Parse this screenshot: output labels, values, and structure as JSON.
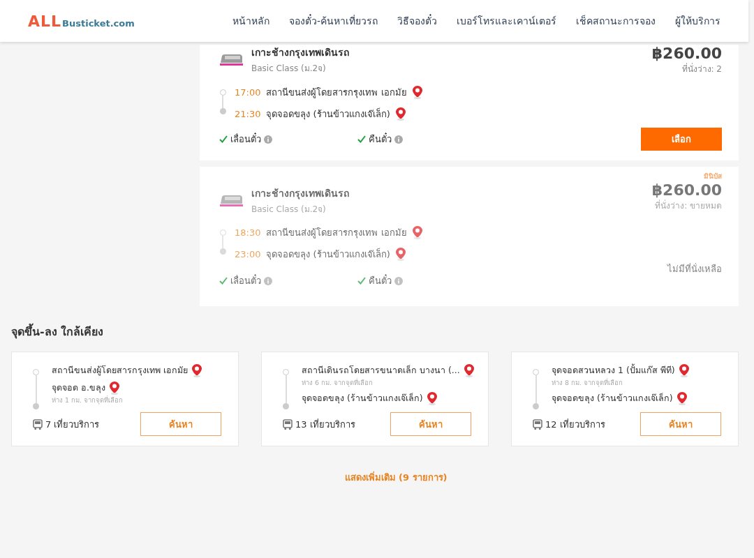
{
  "header": {
    "logo_main": "ALL",
    "logo_sub": "Busticket.com",
    "nav": [
      {
        "label": "หน้าหลัก"
      },
      {
        "label": "จองตั๋ว-ค้นหาเที่ยวรถ"
      },
      {
        "label": "วิธีจองตั๋ว"
      },
      {
        "label": "เบอร์โทรและเคาน์เตอร์"
      },
      {
        "label": "เช็คสถานะการจอง"
      },
      {
        "label": "ผู้ให้บริการ"
      }
    ]
  },
  "trips": [
    {
      "operator": "เกาะช้างกรุงเทพเดินรถ",
      "bus_class": "Basic Class (ม.2จ)",
      "price": "฿260.00",
      "seats": "ที่นั่งว่าง: 2",
      "available": true,
      "stops": [
        {
          "time": "17:00",
          "place": "สถานีขนส่งผู้โดยสารกรุงเทพ เอกมัย"
        },
        {
          "time": "21:30",
          "place": "จุดจอดขลุง (ร้านข้าวแกงเจ๊เล็ก)"
        }
      ],
      "features": [
        {
          "label": "เลื่อนตั๋ว"
        },
        {
          "label": "คืนตั๋ว"
        }
      ],
      "action": "เลือก"
    },
    {
      "badge": "มินิบัส",
      "operator": "เกาะช้างกรุงเทพเดินรถ",
      "bus_class": "Basic Class (ม.2จ)",
      "price": "฿260.00",
      "seats": "ที่นั่งว่าง: ขายหมด",
      "available": false,
      "stops": [
        {
          "time": "18:30",
          "place": "สถานีขนส่งผู้โดยสารกรุงเทพ เอกมัย"
        },
        {
          "time": "23:00",
          "place": "จุดจอดขลุง (ร้านข้าวแกงเจ๊เล็ก)"
        }
      ],
      "features": [
        {
          "label": "เลื่อนตั๋ว"
        },
        {
          "label": "คืนตั๋ว"
        }
      ],
      "status": "ไม่มีที่นั่งเหลือ"
    }
  ],
  "nearby": {
    "title": "จุดขึ้น-ลง ใกล้เคียง",
    "routes": [
      {
        "stops": [
          {
            "place": "สถานีขนส่งผู้โดยสารกรุงเทพ เอกมัย"
          },
          {
            "place": "จุดจอด อ.ขลุง",
            "distance": "ห่าง 1 กม. จากจุดที่เลือก"
          }
        ],
        "trips": "7 เที่ยวบริการ",
        "action": "ค้นหา"
      },
      {
        "stops": [
          {
            "place": "สถานีเดินรถโดยสารขนาดเล็ก บางนา (...",
            "distance": "ห่าง 6 กม. จากจุดที่เลือก"
          },
          {
            "place": "จุดจอดขลุง (ร้านข้าวแกงเจ๊เล็ก)"
          }
        ],
        "trips": "13 เที่ยวบริการ",
        "action": "ค้นหา"
      },
      {
        "stops": [
          {
            "place": "จุดจอดสวนหลวง 1 (ปั้มแก๊ส พีที)",
            "distance": "ห่าง 8 กม. จากจุดที่เลือก"
          },
          {
            "place": "จุดจอดขลุง (ร้านข้าวแกงเจ๊เล็ก)"
          }
        ],
        "trips": "12 เที่ยวบริการ",
        "action": "ค้นหา"
      }
    ],
    "more": "แสดงเพิ่มเติม (9 รายการ)"
  }
}
